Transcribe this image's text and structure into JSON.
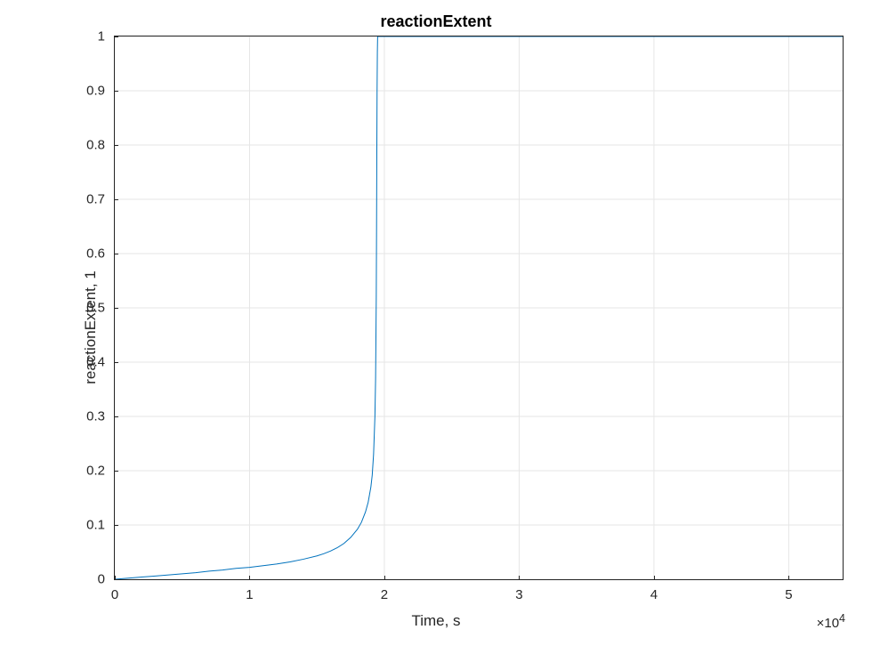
{
  "chart_data": {
    "type": "line",
    "title": "reactionExtent",
    "xlabel": "Time, s",
    "ylabel": "reactionExtent, 1",
    "x_exponent_label": "×10",
    "x_exponent_sup": "4",
    "xlim": [
      0,
      54000
    ],
    "ylim": [
      0,
      1
    ],
    "xticks": [
      0,
      10000,
      20000,
      30000,
      40000,
      50000
    ],
    "xtick_labels": [
      "0",
      "1",
      "2",
      "3",
      "4",
      "5"
    ],
    "yticks": [
      0,
      0.1,
      0.2,
      0.3,
      0.4,
      0.5,
      0.6,
      0.7,
      0.8,
      0.9,
      1
    ],
    "ytick_labels": [
      "0",
      "0.1",
      "0.2",
      "0.3",
      "0.4",
      "0.5",
      "0.6",
      "0.7",
      "0.8",
      "0.9",
      "1"
    ],
    "series": [
      {
        "name": "reactionExtent",
        "color": "#0072bd",
        "x": [
          0,
          1000,
          2000,
          3000,
          4000,
          5000,
          6000,
          7000,
          8000,
          9000,
          10000,
          11000,
          12000,
          13000,
          14000,
          15000,
          15500,
          16000,
          16500,
          17000,
          17500,
          18000,
          18300,
          18600,
          18800,
          19000,
          19100,
          19200,
          19300,
          19350,
          19400,
          19420,
          19440,
          19460,
          19480,
          19500,
          19500,
          54000
        ],
        "y": [
          0.0,
          0.002,
          0.004,
          0.006,
          0.008,
          0.01,
          0.012,
          0.015,
          0.017,
          0.02,
          0.022,
          0.025,
          0.028,
          0.032,
          0.037,
          0.043,
          0.047,
          0.052,
          0.058,
          0.066,
          0.077,
          0.092,
          0.105,
          0.124,
          0.142,
          0.17,
          0.192,
          0.23,
          0.3,
          0.37,
          0.52,
          0.64,
          0.78,
          0.9,
          0.97,
          1.0,
          1.0,
          1.0
        ]
      }
    ]
  }
}
